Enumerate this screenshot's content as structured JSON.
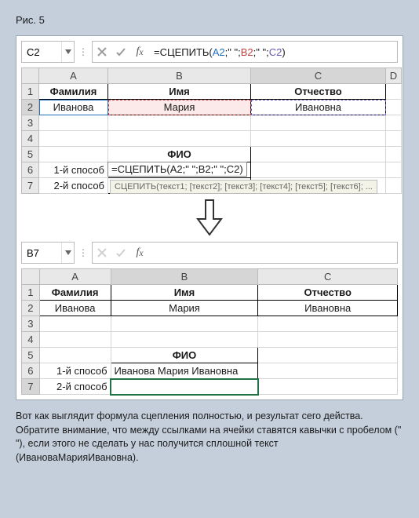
{
  "caption": "Рис. 5",
  "top": {
    "namebox": "C2",
    "formula": {
      "fn": "=СЦЕПИТЬ(",
      "a": "A2",
      "s1": ";\" \";",
      "b": "B2",
      "s2": ";\" \";",
      "c": "C2",
      "end": ")"
    },
    "cols": {
      "a": "A",
      "b": "B",
      "c": "C",
      "d": "D"
    },
    "rows": {
      "r1": "1",
      "r2": "2",
      "r3": "3",
      "r4": "4",
      "r5": "5",
      "r6": "6",
      "r7": "7"
    },
    "h_fam": "Фамилия",
    "h_name": "Имя",
    "h_patr": "Отчество",
    "v_fam": "Иванова",
    "v_name": "Мария",
    "v_patr": "Ивановна",
    "h_fio": "ФИО",
    "way1": "1-й способ",
    "way2": "2-й способ",
    "edit": {
      "pre": "=СЦЕПИТЬ(",
      "a": "А2",
      "s1": ";\" \";",
      "b": "В2",
      "s2": ";\" \";",
      "c": "С2",
      "end": ")"
    },
    "tooltip": "СЦЕПИТЬ(текст1; [текст2]; [текст3]; [текст4]; [текст5]; [текст6]; ..."
  },
  "bottom": {
    "namebox": "B7",
    "formula": "",
    "cols": {
      "a": "A",
      "b": "B",
      "c": "C"
    },
    "rows": {
      "r1": "1",
      "r2": "2",
      "r3": "3",
      "r4": "4",
      "r5": "5",
      "r6": "6",
      "r7": "7"
    },
    "h_fam": "Фамилия",
    "h_name": "Имя",
    "h_patr": "Отчество",
    "v_fam": "Иванова",
    "v_name": "Мария",
    "v_patr": "Ивановна",
    "h_fio": "ФИО",
    "way1": "1-й способ",
    "way2": "2-й способ",
    "result": "Иванова Мария Ивановна"
  },
  "footnote": "Вот как выглядит формула сцепления полностью, и результат сего действа. Обратите внимание, что между ссылками на ячейки ставятся кавычки с пробелом (\" \"), если этого не сделать у нас получится сплошной текст (ИвановаМарияИвановна)."
}
